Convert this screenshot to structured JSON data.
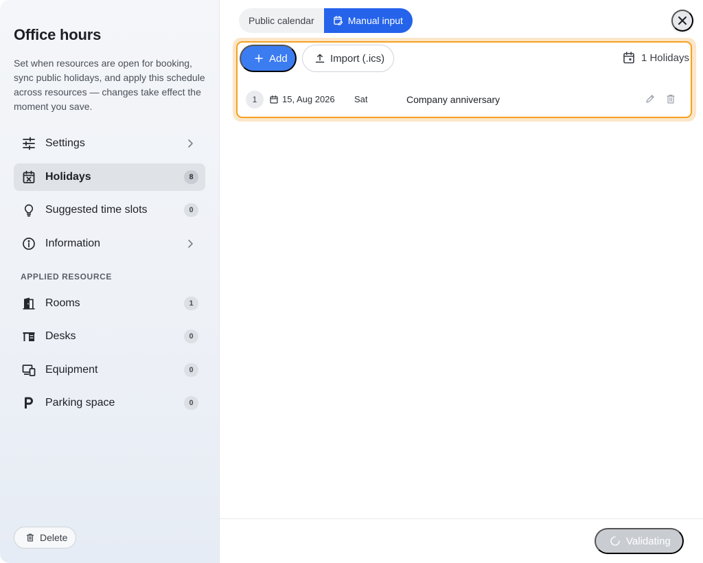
{
  "sidebar": {
    "title": "Office hours",
    "description": "Set when resources are open for booking, sync public holidays, and apply this schedule across resources — changes take effect the moment you save.",
    "nav": [
      {
        "label": "Settings",
        "icon": "sliders-icon",
        "trailing": "chevron"
      },
      {
        "label": "Holidays",
        "icon": "calendar-x-icon",
        "badge": "8",
        "active": true
      },
      {
        "label": "Suggested time slots",
        "icon": "lightbulb-icon",
        "badge": "0"
      },
      {
        "label": "Information",
        "icon": "info-icon",
        "trailing": "chevron"
      }
    ],
    "section_heading": "APPLIED RESOURCE",
    "resources": [
      {
        "label": "Rooms",
        "icon": "door-icon",
        "badge": "1"
      },
      {
        "label": "Desks",
        "icon": "desk-icon",
        "badge": "0"
      },
      {
        "label": "Equipment",
        "icon": "devices-icon",
        "badge": "0"
      },
      {
        "label": "Parking space",
        "icon": "parking-icon",
        "badge": "0"
      }
    ],
    "delete_label": "Delete"
  },
  "main": {
    "segments": [
      {
        "label": "Public calendar",
        "selected": false
      },
      {
        "label": "Manual input",
        "selected": true
      }
    ],
    "toolbar": {
      "add_label": "Add",
      "import_label": "Import (.ics)",
      "holiday_count": "1 Holidays"
    },
    "holidays": [
      {
        "index": "1",
        "date": "15, Aug 2026",
        "weekday": "Sat",
        "name": "Company anniversary"
      }
    ],
    "footer": {
      "validating_label": "Validating"
    }
  },
  "colors": {
    "accent": "#2563eb",
    "add_button": "#3b7cf1",
    "highlight_border": "#f4a020",
    "highlight_glow": "#fbe6c8",
    "disabled_button": "#c9ccd1"
  }
}
